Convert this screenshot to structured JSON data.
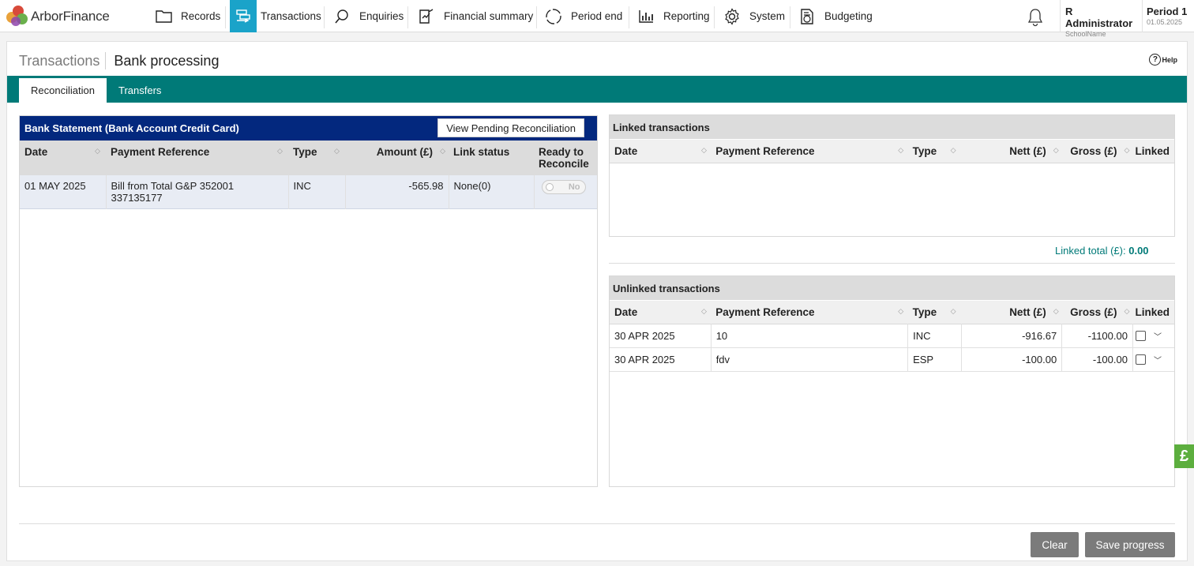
{
  "app": {
    "logo_text": "ArborFinance"
  },
  "nav": {
    "items": [
      {
        "label": "Records",
        "icon": "folder-icon"
      },
      {
        "label": "Transactions",
        "icon": "transactions-icon"
      },
      {
        "label": "Enquiries",
        "icon": "search-icon"
      },
      {
        "label": "Financial summary",
        "icon": "chart-doc-icon"
      },
      {
        "label": "Period end",
        "icon": "cycle-icon"
      },
      {
        "label": "Reporting",
        "icon": "bar-chart-icon"
      },
      {
        "label": "System",
        "icon": "gear-icon"
      },
      {
        "label": "Budgeting",
        "icon": "budget-icon"
      }
    ],
    "active": "Transactions"
  },
  "user": {
    "name": "R Administrator",
    "school": "SchoolName"
  },
  "period": {
    "label": "Period 1",
    "date": "01.05.2025"
  },
  "page": {
    "breadcrumb_parent": "Transactions",
    "title": "Bank processing",
    "help": "Help"
  },
  "tabs": [
    {
      "label": "Reconciliation",
      "active": true
    },
    {
      "label": "Transfers",
      "active": false
    }
  ],
  "statement": {
    "title": "Bank Statement (Bank Account Credit Card)",
    "view_pending_label": "View Pending Reconciliation",
    "columns": [
      "Date",
      "Payment Reference",
      "Type",
      "Amount (£)",
      "Link status",
      "Ready to Reconcile"
    ],
    "ready_line1": "Ready to",
    "ready_line2": "Reconcile",
    "rows": [
      {
        "date": "01 MAY 2025",
        "ref_line1": "Bill from Total G&P 352001",
        "ref_line2": "337135177",
        "type": "INC",
        "amount": "-565.98",
        "link_status": "None(0)",
        "ready": "No"
      }
    ]
  },
  "linked": {
    "title": "Linked transactions",
    "columns": [
      "Date",
      "Payment Reference",
      "Type",
      "Nett (£)",
      "Gross (£)",
      "Linked"
    ],
    "total_label": "Linked total (£):",
    "total_value": "0.00"
  },
  "unlinked": {
    "title": "Unlinked transactions",
    "columns": [
      "Date",
      "Payment Reference",
      "Type",
      "Nett (£)",
      "Gross (£)",
      "Linked"
    ],
    "rows": [
      {
        "date": "30 APR 2025",
        "ref": "10",
        "type": "INC",
        "nett": "-916.67",
        "gross": "-1100.00"
      },
      {
        "date": "30 APR 2025",
        "ref": "fdv",
        "type": "ESP",
        "nett": "-100.00",
        "gross": "-100.00"
      }
    ]
  },
  "actions": {
    "clear": "Clear",
    "save": "Save progress"
  },
  "side_tab": {
    "symbol": "£"
  },
  "colors": {
    "teal": "#007a78",
    "navy": "#03287e",
    "nav_active": "#1aa3c9",
    "button_grey": "#7b7b7b",
    "side_green": "#5cae3e"
  }
}
